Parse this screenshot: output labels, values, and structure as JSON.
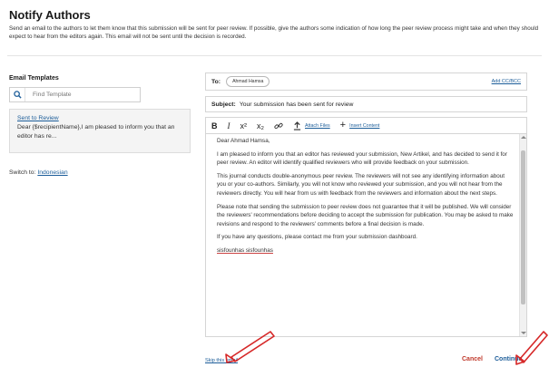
{
  "header": {
    "title": "Notify Authors",
    "description": "Send an email to the authors to let them know that this submission will be sent for peer review. If possible, give the authors some indication of how long the peer review process might take and when they should expect to hear from the editors again. This email will not be sent until the decision is recorded."
  },
  "templates": {
    "heading": "Email Templates",
    "search_placeholder": "Find Template",
    "item": {
      "title": "Sent to Review",
      "preview": "Dear {$recipientName},I am pleased to inform you that an editor has re..."
    },
    "switch_label": "Switch to:",
    "switch_language": "Indonesian"
  },
  "composer": {
    "to_label": "To:",
    "recipient": "Ahmad Hamsa",
    "add_cc_bcc": "Add CC/BCC",
    "subject_label": "Subject:",
    "subject_value": "Your submission has been sent for review",
    "toolbar": {
      "bold": "B",
      "italic": "I",
      "superscript": "x²",
      "subscript": "x₂",
      "attach_files": "Attach Files",
      "insert_content": "Insert Content"
    },
    "body": {
      "greeting": "Dear Ahmad Hamsa,",
      "p1": "I am pleased to inform you that an editor has reviewed your submission, New Artikel, and has decided to send it for peer review. An editor will identify qualified reviewers who will provide feedback on your submission.",
      "p2": "This journal conducts double-anonymous peer review. The reviewers will not see any identifying information about you or your co-authors. Similarly, you will not know who reviewed your submission, and you will not hear from the reviewers directly. You will hear from us with feedback from the reviewers and information about the next steps.",
      "p3": "Please note that sending the submission to peer review does not guarantee that it will be published. We will consider the reviewers' recommendations before deciding to accept the submission for publication. You may be asked to make revisions and respond to the reviewers' comments before a final decision is made.",
      "p4": "If you have any questions, please contact me from your submission dashboard.",
      "signature": "sisfounhas sisfounhas"
    }
  },
  "footer": {
    "skip_email": "Skip this email",
    "cancel": "Cancel",
    "continue": "Continue"
  },
  "colors": {
    "link": "#1c5d99",
    "cancel": "#c0392b",
    "annotation_arrow": "#d62828"
  }
}
